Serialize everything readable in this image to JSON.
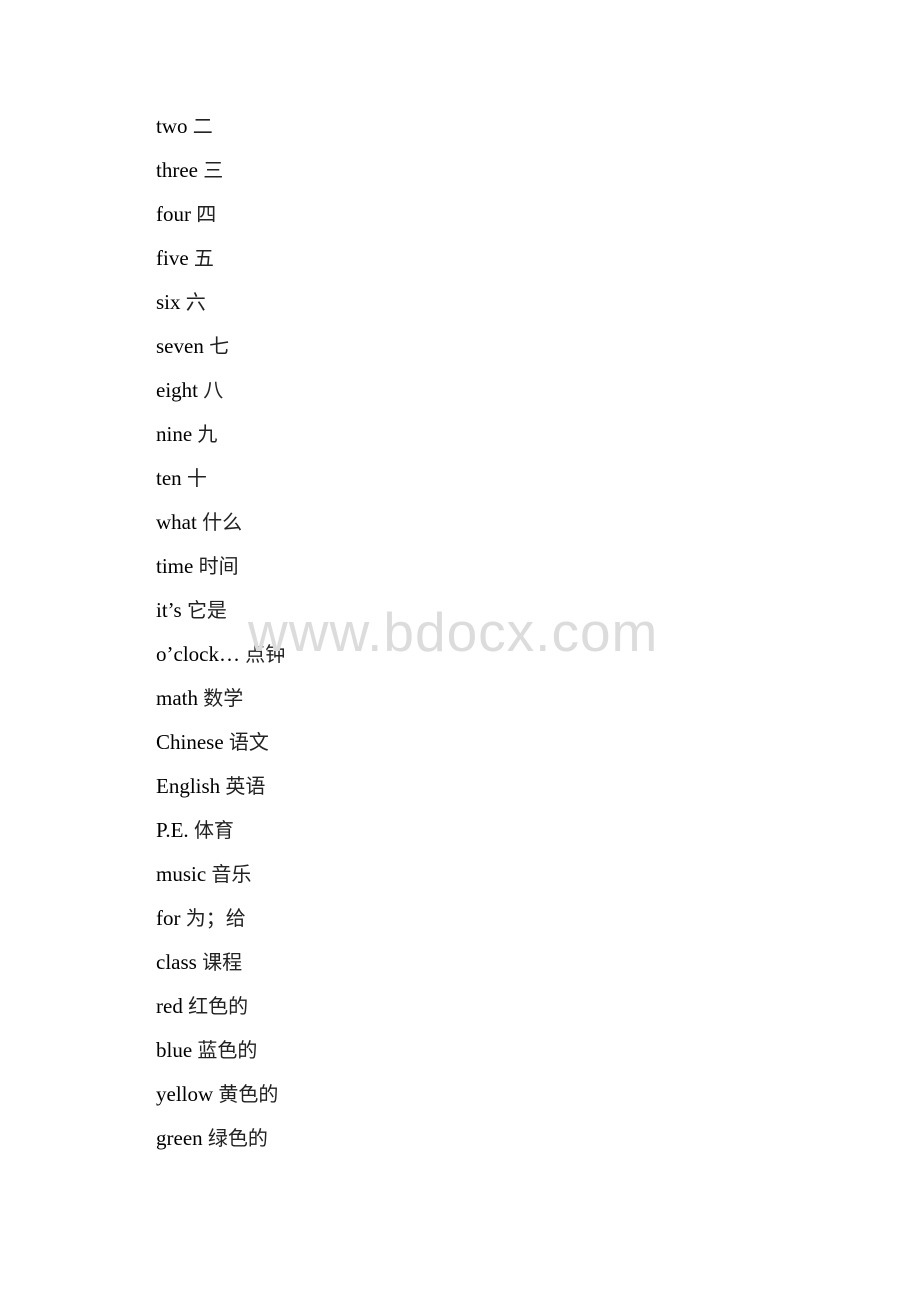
{
  "document": {
    "watermark": "www.bdocx.com",
    "vocabulary": [
      {
        "en": "two",
        "zh": "二"
      },
      {
        "en": "three",
        "zh": "三"
      },
      {
        "en": "four",
        "zh": "四"
      },
      {
        "en": "five",
        "zh": "五"
      },
      {
        "en": "six",
        "zh": "六"
      },
      {
        "en": "seven",
        "zh": "七"
      },
      {
        "en": "eight",
        "zh": "八"
      },
      {
        "en": "nine",
        "zh": "九"
      },
      {
        "en": "ten",
        "zh": "十"
      },
      {
        "en": "what",
        "zh": "什么"
      },
      {
        "en": "time",
        "zh": "时间"
      },
      {
        "en": "it’s",
        "zh": "它是"
      },
      {
        "en": "o’clock…",
        "zh": "点钟"
      },
      {
        "en": "math",
        "zh": "数学"
      },
      {
        "en": "Chinese",
        "zh": "语文"
      },
      {
        "en": "English",
        "zh": "英语"
      },
      {
        "en": "P.E.",
        "zh": "体育"
      },
      {
        "en": "music",
        "zh": "音乐"
      },
      {
        "en": "for",
        "zh": "为；给"
      },
      {
        "en": "class",
        "zh": "课程"
      },
      {
        "en": "red",
        "zh": "红色的"
      },
      {
        "en": "blue",
        "zh": "蓝色的"
      },
      {
        "en": "yellow",
        "zh": "黄色的"
      },
      {
        "en": "green",
        "zh": "绿色的"
      }
    ]
  }
}
